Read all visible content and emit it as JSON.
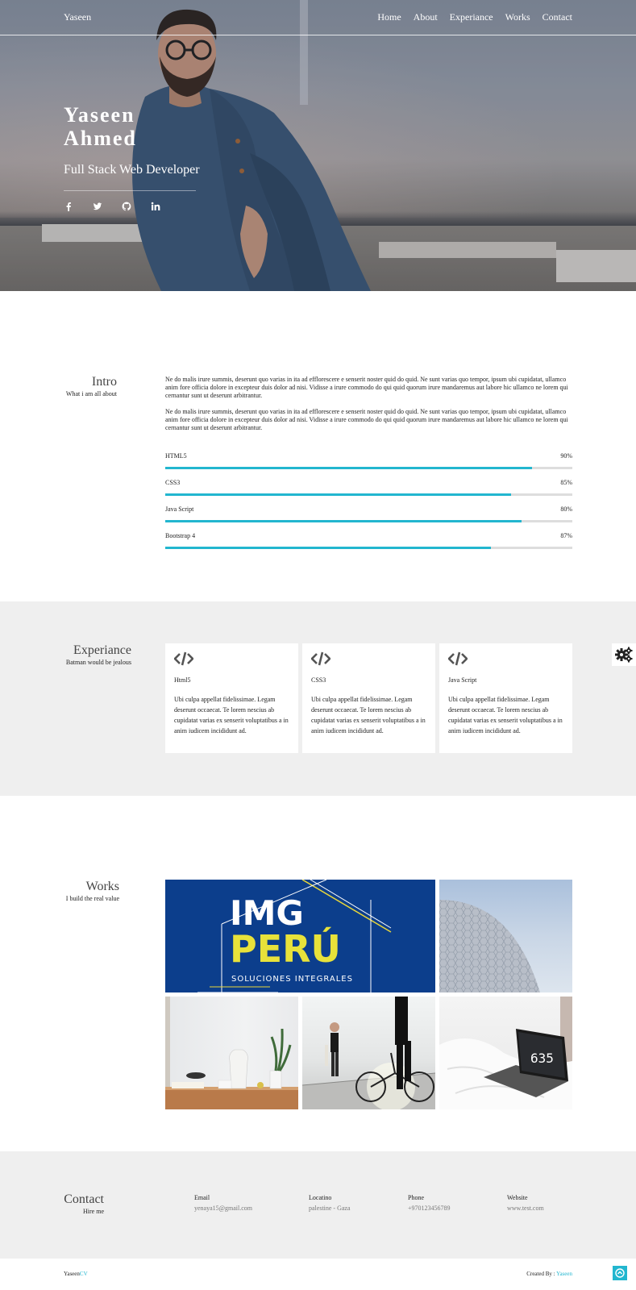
{
  "nav": {
    "brand": "Yaseen",
    "links": [
      "Home",
      "About",
      "Experiance",
      "Works",
      "Contact"
    ]
  },
  "hero": {
    "first_name": "Yaseen",
    "last_name": "Ahmed",
    "role": "Full Stack Web Developer",
    "socials": [
      "facebook-icon",
      "twitter-icon",
      "github-icon",
      "linkedin-icon"
    ]
  },
  "intro": {
    "title": "Intro",
    "subtitle": "What i am all about",
    "paragraphs": [
      "Ne do malis irure summis, deserunt quo varias in ita ad efflorescere e senserit noster quid do quid. Ne sunt varias quo tempor, ipsum ubi cupidatat, ullamco anim fore officia dolore in excepteur duis dolor ad nisi. Vidisse a irure commodo do qui quid quorum irure mandaremus aut labore hic ullamco ne lorem qui cernantur sunt ut deserunt arbitrantur.",
      "Ne do malis irure summis, deserunt quo varias in ita ad efflorescere e senserit noster quid do quid. Ne sunt varias quo tempor, ipsum ubi cupidatat, ullamco anim fore officia dolore in excepteur duis dolor ad nisi. Vidisse a irure commodo do qui quid quorum irure mandaremus aut labore hic ullamco ne lorem qui cernantur sunt ut deserunt arbitrantur."
    ],
    "skills": [
      {
        "name": "HTML5",
        "percent_label": "90%",
        "fill": 0.9
      },
      {
        "name": "CSS3",
        "percent_label": "85%",
        "fill": 0.85
      },
      {
        "name": "Java Script",
        "percent_label": "80%",
        "fill": 0.875
      },
      {
        "name": "Bootstrap 4",
        "percent_label": "87%",
        "fill": 0.8
      }
    ],
    "accent_color": "#22b6cf"
  },
  "experience": {
    "title": "Experiance",
    "subtitle": "Batman would be jealous",
    "cards": [
      {
        "icon": "code-icon",
        "title": "Html5",
        "text": "Ubi culpa appellat fidelissimae. Legam deserunt occaecat. Te lorem nescius ab cupidatat varias ex senserit voluptatibus a in anim iudicem incididunt ad."
      },
      {
        "icon": "code-icon",
        "title": "CSS3",
        "text": "Ubi culpa appellat fidelissimae. Legam deserunt occaecat. Te lorem nescius ab cupidatat varias ex senserit voluptatibus a in anim iudicem incididunt ad."
      },
      {
        "icon": "code-icon",
        "title": "Java Script",
        "text": "Ubi culpa appellat fidelissimae. Legam deserunt occaecat. Te lorem nescius ab cupidatat varias ex senserit voluptatibus a in anim iudicem incididunt ad."
      }
    ]
  },
  "works": {
    "title": "Works",
    "subtitle": "I build the real value",
    "featured": {
      "line1": "IMG",
      "line2": "PERÚ",
      "line3": "SOLUCIONES INTEGRALES"
    }
  },
  "contact": {
    "title": "Contact",
    "subtitle": "Hire me",
    "items": [
      {
        "label": "Email",
        "value": "yenaya15@gmail.com"
      },
      {
        "label": "Locatino",
        "value": "palestine - Gaza"
      },
      {
        "label": "Phone",
        "value": "+970123456789"
      },
      {
        "label": "Website",
        "value": "www.test.com"
      }
    ]
  },
  "footer": {
    "brand_main": "Yaseen",
    "brand_accent": "CV",
    "credit_prefix": "Created By :",
    "credit_name": "Yaseen"
  }
}
